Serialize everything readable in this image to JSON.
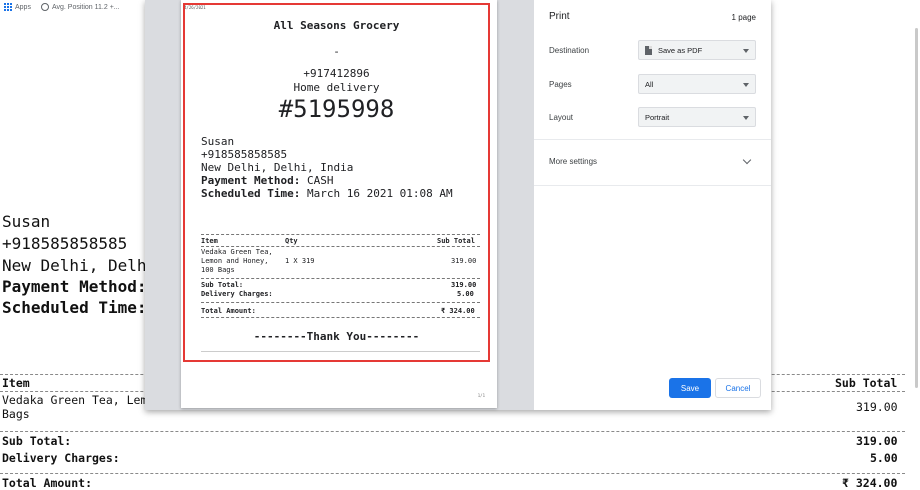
{
  "bookmarks": {
    "apps_label": "Apps",
    "item1_label": "Avg. Position 11.2 +..."
  },
  "background": {
    "customer_name": "Susan",
    "customer_phone": "+918585858585",
    "customer_address": "New Delhi, Delh",
    "payment_method_label": "Payment Method:",
    "scheduled_label": "Scheduled Time:",
    "col_item": "Item",
    "col_subtotal": "Sub Total",
    "item_name_line1": "Vedaka Green Tea, Lemo",
    "item_name_line2": "Bags",
    "item_subtotal": "319.00",
    "subtotal_label": "Sub Total:",
    "subtotal_value": "319.00",
    "delivery_label": "Delivery Charges:",
    "delivery_value": "5.00",
    "total_label": "Total Amount:",
    "total_value": "₹ 324.00"
  },
  "preview": {
    "date": "4/26/2021",
    "store_name": "All Seasons Grocery",
    "dash": "-",
    "store_phone": "+917412896",
    "delivery_mode": "Home delivery",
    "order_number": "#5195998",
    "customer_name": "Susan",
    "customer_phone": "+918585858585",
    "customer_address": "New Delhi, Delhi, India",
    "payment_method_label": "Payment Method:",
    "payment_method_value": "CASH",
    "scheduled_label": "Scheduled Time:",
    "scheduled_value": "March 16 2021 01:08 AM",
    "col_item": "Item",
    "col_qty": "Qty",
    "col_subtotal": "Sub Total",
    "item_line1": "Vedaka Green Tea,",
    "item_line2": "Lemon and Honey,",
    "item_line3": "100 Bags",
    "item_qty": "1 X 319",
    "item_subtotal": "319.00",
    "subtotal_label": "Sub Total:",
    "subtotal_value": "319.00",
    "delivery_label": "Delivery Charges:",
    "delivery_value": "5.00",
    "total_label": "Total Amount:",
    "total_value": "₹ 324.00",
    "thanks": "--------Thank You--------",
    "page_number": "1/1"
  },
  "settings": {
    "title": "Print",
    "page_count": "1 page",
    "destination_label": "Destination",
    "destination_value": "Save as PDF",
    "pages_label": "Pages",
    "pages_value": "All",
    "layout_label": "Layout",
    "layout_value": "Portrait",
    "more_settings": "More settings",
    "save_label": "Save",
    "cancel_label": "Cancel"
  },
  "colors": {
    "highlight": "#e53935",
    "accent": "#1a73e8"
  }
}
